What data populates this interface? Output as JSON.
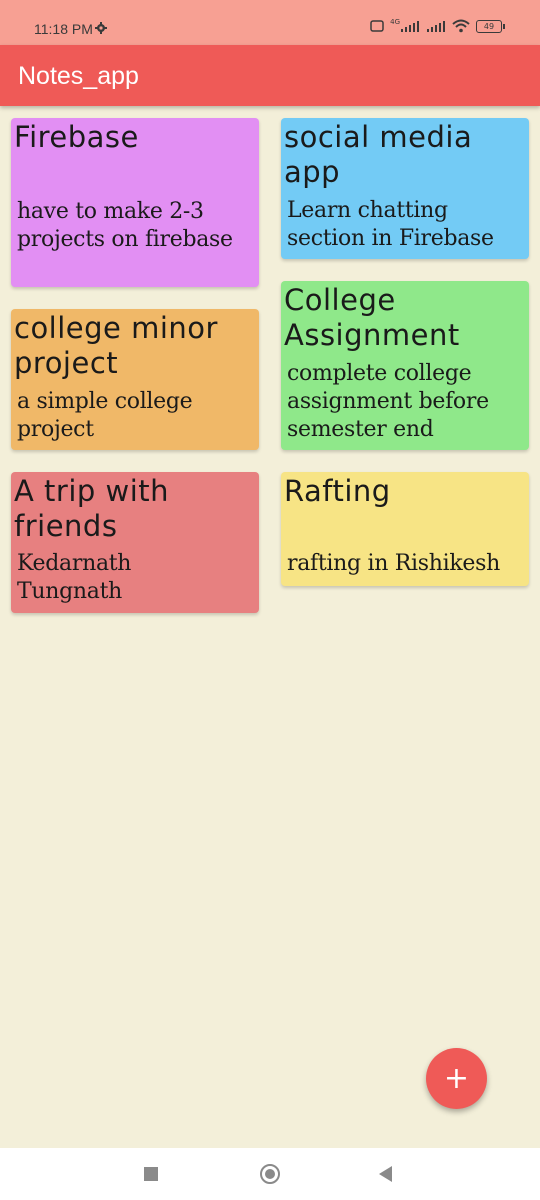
{
  "status": {
    "time": "11:18 PM",
    "battery": "49",
    "network": "4G"
  },
  "app": {
    "title": "Notes_app"
  },
  "notes": [
    {
      "title": "Firebase",
      "body": "have to make 2-3 projects on firebase",
      "color": "#e28ff3"
    },
    {
      "title": "social media app",
      "body": "Learn chatting section in Firebase",
      "color": "#73cbf5"
    },
    {
      "title": "college minor project",
      "body": "a simple college project",
      "color": "#f0b868"
    },
    {
      "title": "College Assignment",
      "body": "complete college assignment before semester end",
      "color": "#8fe88a"
    },
    {
      "title": "A trip with friends",
      "body": "Kedarnath Tungnath",
      "color": "#e78080"
    },
    {
      "title": "Rafting",
      "body": "rafting in Rishikesh",
      "color": "#f7e485"
    }
  ],
  "fab": {
    "label": "+"
  },
  "icons": {
    "settings": "gear-icon",
    "wifi": "wifi-icon",
    "signal": "signal-icon",
    "battery": "battery-icon"
  }
}
